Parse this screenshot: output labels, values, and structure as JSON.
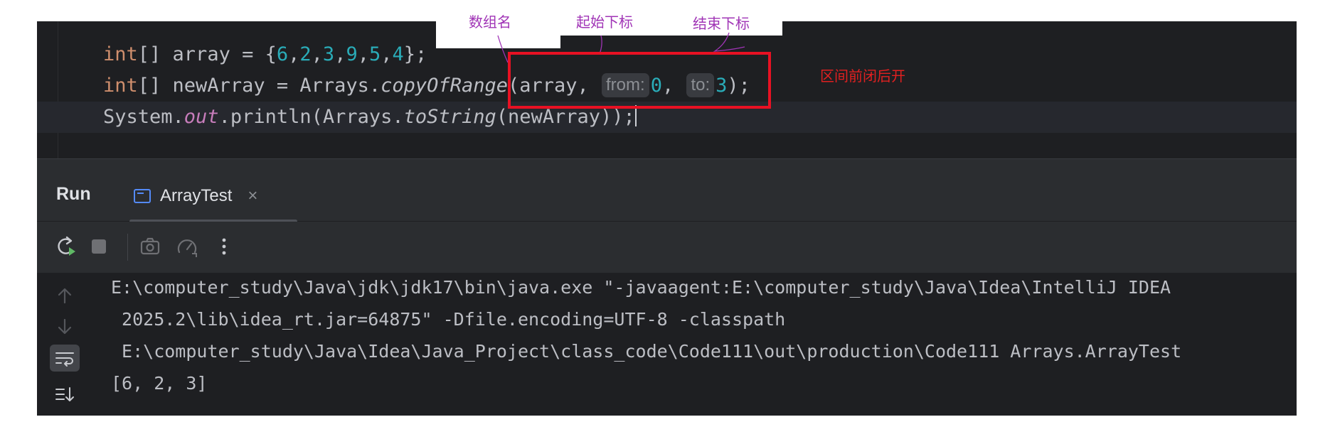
{
  "editor": {
    "line1": {
      "kw": "int",
      "before_nums": "[] array = {",
      "nums": [
        "6",
        "2",
        "3",
        "9",
        "5",
        "4"
      ],
      "after_nums": "};"
    },
    "line2": {
      "kw": "int",
      "prefix": "[] newArray = Arrays.",
      "method": "copyOfRange",
      "arg1": "(array, ",
      "hint_from": "from:",
      "from_value": "0",
      "comma": ", ",
      "hint_to": "to:",
      "to_value": "3",
      "close": ");"
    },
    "line3": {
      "cls": "System.",
      "field": "out",
      "middle": ".println(Arrays.",
      "method": "toString",
      "args": "(newArray));"
    }
  },
  "run_window": {
    "title": "Run",
    "tab_label": "ArrayTest",
    "tab_close": "×",
    "toolbar_icons": [
      "rerun-icon",
      "stop-icon",
      "camera-icon",
      "speedometer-icon",
      "more-vertical-icon"
    ],
    "console_lines": [
      "E:\\computer_study\\Java\\jdk\\jdk17\\bin\\java.exe \"-javaagent:E:\\computer_study\\Java\\Idea\\IntelliJ IDEA",
      " 2025.2\\lib\\idea_rt.jar=64875\" -Dfile.encoding=UTF-8 -classpath",
      " E:\\computer_study\\Java\\Idea\\Java_Project\\class_code\\Code111\\out\\production\\Code111 Arrays.ArrayTest",
      "[6, 2, 3]"
    ]
  },
  "annotations": {
    "array_name": "数组名",
    "start_index": "起始下标",
    "end_index": "结束下标",
    "interval_note": "区间前闭后开"
  },
  "colors": {
    "editor_bg": "#1e1f22",
    "keyword": "#cf8e6d",
    "number": "#2aacb8",
    "field": "#c77dbb",
    "annotation_purple": "#a034b6",
    "annotation_red": "#e02020"
  }
}
